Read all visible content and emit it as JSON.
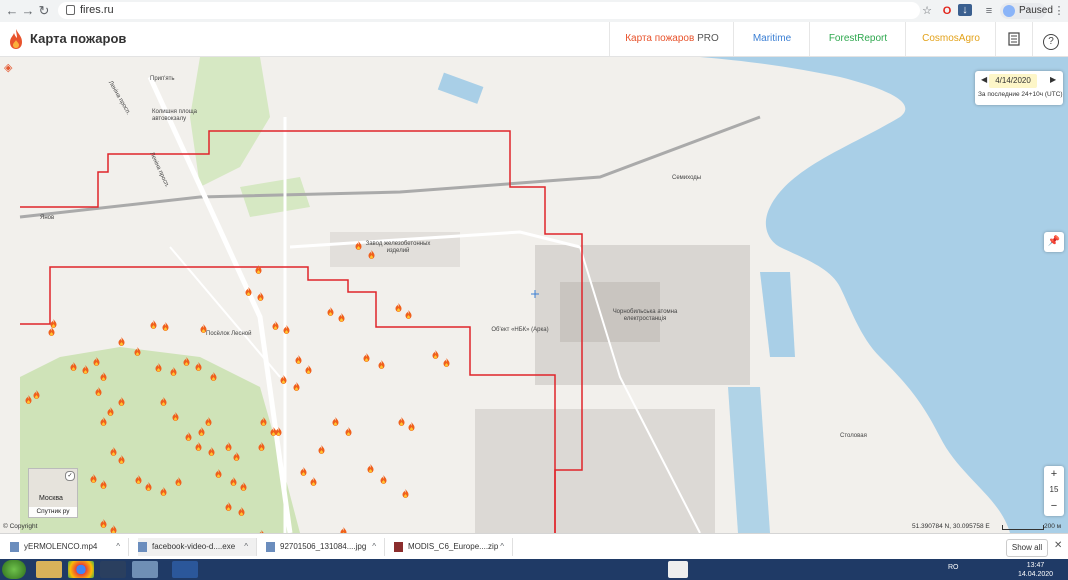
{
  "browser": {
    "url": "fires.ru",
    "profile_label": "Paused"
  },
  "site": {
    "title": "Карта пожаров",
    "nav": [
      {
        "label": "Карта пожаров",
        "suffix": "PRO",
        "color": "#e8532c"
      },
      {
        "label": "Maritime",
        "suffix": "",
        "color": "#3b7fd4"
      },
      {
        "label": "ForestReport",
        "suffix": "",
        "color": "#2fa84f"
      },
      {
        "label": "CosmosAgro",
        "suffix": "",
        "color": "#e3a21a"
      }
    ],
    "icons": [
      "book-icon",
      "help-icon"
    ],
    "help_glyph": "?"
  },
  "map": {
    "date": "4/14/2020",
    "date_range": "За последние 24+10ч (UTC)",
    "labels": {
      "prypiat": "Прип'ять",
      "bus_station": "Колишня площа автовокзалу",
      "lenina_1": "Леніна просп.",
      "lenina_2": "Леніна просп.",
      "yaniv": "Янов",
      "semykhody": "Семиходы",
      "plant": "Завод железобетонных изделий",
      "lesnoy": "Посёлок Лесной",
      "arka": "Об'ект «НБК» (Арка)",
      "npp": "Чорнобильська атомна електростанція",
      "stolovaya": "Столовая"
    },
    "zoom_in": "+",
    "zoom_level": "15",
    "zoom_out": "−",
    "minimap_city": "Москва",
    "minimap_label": "Спутник ру",
    "copyright": "© Copyright",
    "coordinates": "51.390784 N, 30.095758 E",
    "scale_label": "200 м",
    "fire_color": "#f0601c"
  },
  "downloads": {
    "items": [
      {
        "name": "yERMOLENCO.mp4"
      },
      {
        "name": "facebook-video-d....exe"
      },
      {
        "name": "92701506_131084....jpg"
      },
      {
        "name": "MODIS_C6_Europe....zip"
      }
    ],
    "show_all": "Show all"
  },
  "taskbar": {
    "tray_lang": "RO",
    "time": "13:47",
    "date": "14.04.2020"
  }
}
